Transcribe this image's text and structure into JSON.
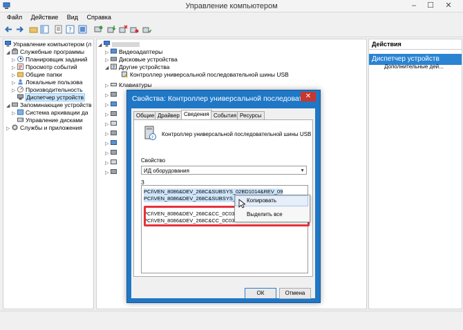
{
  "window": {
    "title": "Управление компьютером",
    "controls": [
      "–",
      "☐",
      "✕"
    ]
  },
  "menu": [
    "Файл",
    "Действие",
    "Вид",
    "Справка"
  ],
  "tree": [
    {
      "label": "Управление компьютером (л",
      "indent": 0,
      "arrow": ""
    },
    {
      "label": "Служебные программы",
      "indent": 1,
      "arrow": "◢"
    },
    {
      "label": "Планировщик заданий",
      "indent": 2,
      "arrow": "▷"
    },
    {
      "label": "Просмотр событий",
      "indent": 2,
      "arrow": "▷"
    },
    {
      "label": "Общие папки",
      "indent": 2,
      "arrow": "▷"
    },
    {
      "label": "Локальные пользова",
      "indent": 2,
      "arrow": "▷"
    },
    {
      "label": "Производительность",
      "indent": 2,
      "arrow": "▷"
    },
    {
      "label": "Диспетчер устройств",
      "indent": 2,
      "arrow": "",
      "selected": true
    },
    {
      "label": "Запоминающие устройств",
      "indent": 1,
      "arrow": "◢"
    },
    {
      "label": "Система архивации да",
      "indent": 2,
      "arrow": "▷"
    },
    {
      "label": "Управление дисками",
      "indent": 2,
      "arrow": ""
    },
    {
      "label": "Службы и приложения",
      "indent": 1,
      "arrow": "▷"
    }
  ],
  "devices": [
    {
      "label": "Видеоадаптеры",
      "indent": 1,
      "arrow": "▷"
    },
    {
      "label": "Дисковые устройства",
      "indent": 1,
      "arrow": "▷"
    },
    {
      "label": "Другие устройства",
      "indent": 1,
      "arrow": "◢"
    },
    {
      "label": "Контроллер универсальной последовательной шины USB",
      "indent": 2,
      "arrow": ""
    },
    {
      "label": "Клавиатуры",
      "indent": 1,
      "arrow": "▷"
    }
  ],
  "actions": {
    "header": "Действия",
    "section": "Диспетчер устройств",
    "more": "Дополнительные дей..."
  },
  "dialog": {
    "title": "Свойства: Контроллер универсальной последоват...",
    "close": "✕",
    "tabs": [
      "Общие",
      "Драйвер",
      "Сведения",
      "События",
      "Ресурсы"
    ],
    "active_tab": "Сведения",
    "device_name": "Контроллер универсальной последовательной шины USB",
    "property_label": "Свойство",
    "property_value": "ИД оборудования",
    "values": [
      "PCI\\VEN_8086&DEV_268C&SUBSYS_02BD1014&REV_09",
      "PCI\\VEN_8086&DEV_268C&SUBSYS_02BD1014",
      "PCI\\VEN_8086&DEV_268C&CC_0C0320",
      "PCI\\VEN_8086&DEV_268C&CC_0C03"
    ],
    "context_menu": [
      "Копировать",
      "Выделить все"
    ],
    "ok": "ОК",
    "cancel": "Отмена"
  },
  "colors": {
    "dialog_frame": "#1f77c6",
    "actions_section": "#2a84d2",
    "highlight_box": "#e8303a",
    "selection": "#cce8ff"
  }
}
